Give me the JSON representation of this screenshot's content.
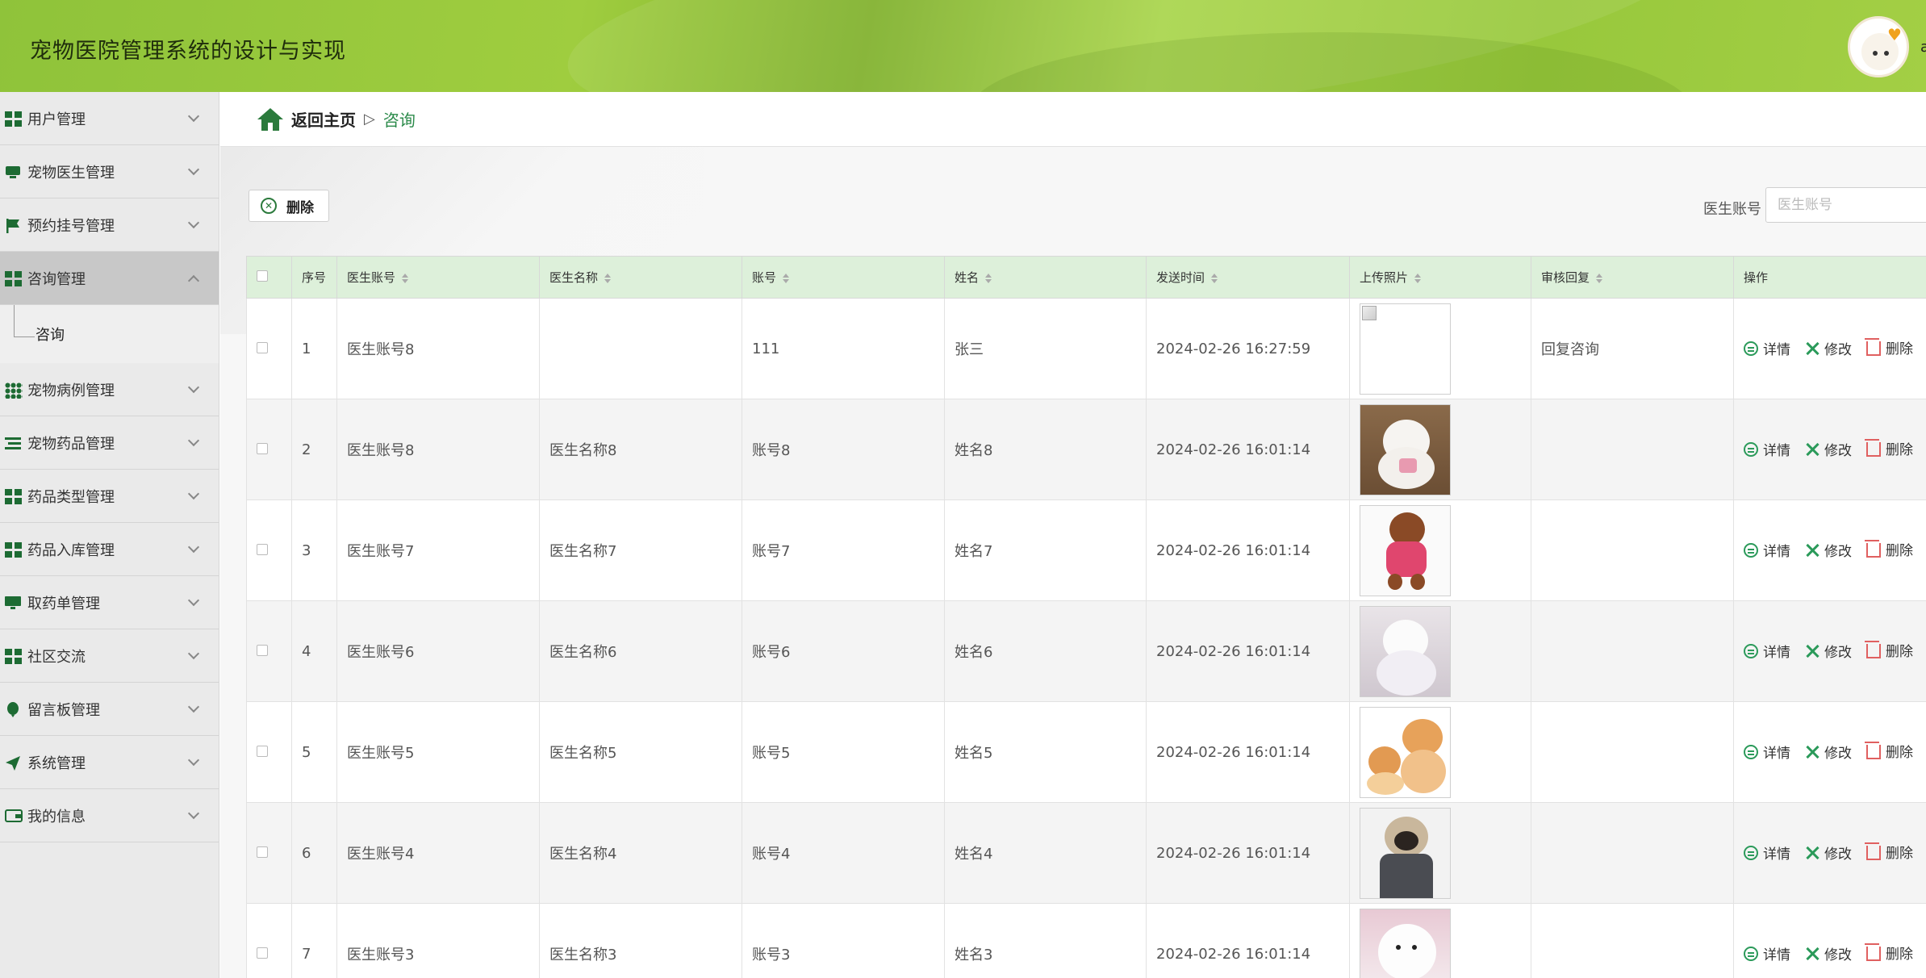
{
  "header": {
    "title": "宠物医院管理系统的设计与实现",
    "user_initial": "a"
  },
  "sidebar": {
    "items": [
      {
        "label": "用户管理",
        "icon": "grid-icon"
      },
      {
        "label": "宠物医生管理",
        "icon": "doctor-icon"
      },
      {
        "label": "预约挂号管理",
        "icon": "flag-icon"
      },
      {
        "label": "咨询管理",
        "icon": "grid-icon",
        "active": true,
        "children": [
          {
            "label": "咨询"
          }
        ]
      },
      {
        "label": "宠物病例管理",
        "icon": "grid9-icon"
      },
      {
        "label": "宠物药品管理",
        "icon": "list-icon"
      },
      {
        "label": "药品类型管理",
        "icon": "grid-icon"
      },
      {
        "label": "药品入库管理",
        "icon": "grid-icon"
      },
      {
        "label": "取药单管理",
        "icon": "monitor-icon"
      },
      {
        "label": "社区交流",
        "icon": "grid-icon"
      },
      {
        "label": "留言板管理",
        "icon": "balloon-icon"
      },
      {
        "label": "系统管理",
        "icon": "send-icon"
      },
      {
        "label": "我的信息",
        "icon": "wallet-icon"
      }
    ]
  },
  "breadcrumb": {
    "home": "返回主页",
    "separator": "▷",
    "current": "咨询"
  },
  "toolbar": {
    "delete_label": "删除",
    "search_label": "医生账号",
    "search_placeholder": "医生账号"
  },
  "table": {
    "headers": [
      "序号",
      "医生账号",
      "医生名称",
      "账号",
      "姓名",
      "发送时间",
      "上传照片",
      "审核回复",
      "操作"
    ],
    "actions": {
      "detail": "详情",
      "edit": "修改",
      "delete": "删除"
    },
    "rows": [
      {
        "index": "1",
        "doctor_account": "医生账号8",
        "doctor_name": "",
        "account": "111",
        "name": "张三",
        "time": "2024-02-26 16:27:59",
        "photo": "broken-image",
        "reply": "回复咨询"
      },
      {
        "index": "2",
        "doctor_account": "医生账号8",
        "doctor_name": "医生名称8",
        "account": "账号8",
        "name": "姓名8",
        "time": "2024-02-26 16:01:14",
        "photo": "white-pomeranian",
        "reply": ""
      },
      {
        "index": "3",
        "doctor_account": "医生账号7",
        "doctor_name": "医生名称7",
        "account": "账号7",
        "name": "姓名7",
        "time": "2024-02-26 16:01:14",
        "photo": "brown-poodle",
        "reply": ""
      },
      {
        "index": "4",
        "doctor_account": "医生账号6",
        "doctor_name": "医生名称6",
        "account": "账号6",
        "name": "姓名6",
        "time": "2024-02-26 16:01:14",
        "photo": "white-dog-bride",
        "reply": ""
      },
      {
        "index": "5",
        "doctor_account": "医生账号5",
        "doctor_name": "医生名称5",
        "account": "账号5",
        "name": "姓名5",
        "time": "2024-02-26 16:01:14",
        "photo": "orange-cats",
        "reply": ""
      },
      {
        "index": "6",
        "doctor_account": "医生账号4",
        "doctor_name": "医生名称4",
        "account": "账号4",
        "name": "姓名4",
        "time": "2024-02-26 16:01:14",
        "photo": "pug-in-suit",
        "reply": ""
      },
      {
        "index": "7",
        "doctor_account": "医生账号3",
        "doctor_name": "医生名称3",
        "account": "账号3",
        "name": "姓名3",
        "time": "2024-02-26 16:01:14",
        "photo": "white-puppy",
        "reply": ""
      }
    ]
  },
  "colors": {
    "header_green": "#9cc93f",
    "accent_green": "#2b7a3c",
    "table_header_bg": "#ddf0da",
    "delete_red": "#e06060"
  }
}
